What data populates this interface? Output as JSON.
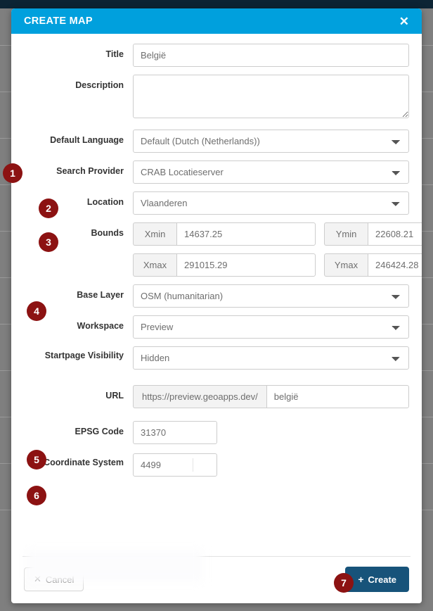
{
  "modal": {
    "title": "CREATE MAP",
    "close_icon": "close-icon",
    "header_color": "#00a0dd"
  },
  "form": {
    "title": {
      "label": "Title",
      "value": "België"
    },
    "description": {
      "label": "Description",
      "value": ""
    },
    "default_language": {
      "label": "Default Language",
      "value": "Default (Dutch (Netherlands))"
    },
    "search_provider": {
      "label": "Search Provider",
      "value": "CRAB Locatieserver"
    },
    "location": {
      "label": "Location",
      "value": "Vlaanderen"
    },
    "bounds": {
      "label": "Bounds",
      "xmin": {
        "addon": "Xmin",
        "value": "14637.25"
      },
      "ymin": {
        "addon": "Ymin",
        "value": "22608.21"
      },
      "xmax": {
        "addon": "Xmax",
        "value": "291015.29"
      },
      "ymax": {
        "addon": "Ymax",
        "value": "246424.28"
      }
    },
    "base_layer": {
      "label": "Base Layer",
      "value": "OSM (humanitarian)"
    },
    "workspace": {
      "label": "Workspace",
      "value": "Preview"
    },
    "startpage_visibility": {
      "label": "Startpage Visibility",
      "value": "Hidden"
    },
    "url": {
      "label": "URL",
      "prefix": "https://preview.geoapps.dev/",
      "value": "belgië"
    },
    "epsg_code": {
      "label": "EPSG Code",
      "value": "31370"
    },
    "coordinate_system": {
      "label": "Coordinate System",
      "value": "4499"
    }
  },
  "footer": {
    "cancel": {
      "label": "Cancel",
      "glyph": "✕"
    },
    "create": {
      "label": "Create",
      "glyph": "+"
    }
  },
  "callouts": {
    "one": "1",
    "two": "2",
    "three": "3",
    "four": "4",
    "five": "5",
    "six": "6",
    "seven": "7",
    "color": "#8c1212"
  }
}
